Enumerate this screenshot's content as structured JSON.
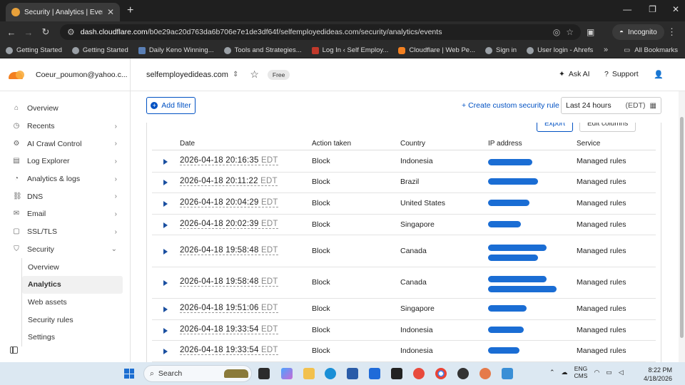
{
  "browser": {
    "tab_title": "Security | Analytics | Events | sel",
    "url_host": "dash.cloudflare.com",
    "url_path": "/b0e29ac20d763da6b706e7e1de3df64f/selfemployedideas.com/security/analytics/events",
    "incognito_label": "Incognito",
    "bookmarks": [
      {
        "label": "Getting Started",
        "icon": "globe-icon"
      },
      {
        "label": "Getting Started",
        "icon": "globe-icon"
      },
      {
        "label": "Daily Keno Winning...",
        "icon": "page-icon"
      },
      {
        "label": "Tools and Strategies...",
        "icon": "globe-icon"
      },
      {
        "label": "Log In ‹ Self Employ...",
        "icon": "page-icon"
      },
      {
        "label": "Cloudflare | Web Pe...",
        "icon": "cloudflare-icon"
      },
      {
        "label": "Sign in",
        "icon": "globe-icon"
      },
      {
        "label": "User login - Ahrefs",
        "icon": "globe-icon"
      }
    ],
    "all_bookmarks": "All Bookmarks"
  },
  "account": {
    "email": "Coeur_poumon@yahoo.c..."
  },
  "sidebar": {
    "items": [
      {
        "label": "Overview",
        "icon": "home-icon",
        "chevron": false
      },
      {
        "label": "Recents",
        "icon": "clock-icon",
        "chevron": true
      },
      {
        "label": "AI Crawl Control",
        "icon": "crawl-icon",
        "chevron": true
      },
      {
        "label": "Log Explorer",
        "icon": "log-icon",
        "chevron": true
      },
      {
        "label": "Analytics & logs",
        "icon": "chart-icon",
        "chevron": true
      },
      {
        "label": "DNS",
        "icon": "dns-icon",
        "chevron": true
      },
      {
        "label": "Email",
        "icon": "email-icon",
        "chevron": true
      },
      {
        "label": "SSL/TLS",
        "icon": "lock-icon",
        "chevron": true
      },
      {
        "label": "Security",
        "icon": "shield-icon",
        "chevron": "down"
      }
    ],
    "security_sub": [
      "Overview",
      "Analytics",
      "Web assets",
      "Security rules",
      "Settings"
    ]
  },
  "topbar": {
    "domain": "selfemployedideas.com",
    "plan": "Free",
    "ask_ai": "Ask AI",
    "support": "Support"
  },
  "toolbar": {
    "add_filter": "Add filter",
    "create_rule": "Create custom security rule",
    "time_range": "Last 24 hours",
    "timezone": "(EDT)",
    "export": "Export",
    "edit_columns": "Edit columns"
  },
  "table": {
    "columns": [
      "Date",
      "Action taken",
      "Country",
      "IP address",
      "Service"
    ],
    "rows": [
      {
        "date": "2026-04-18 20:16:35",
        "tz": "EDT",
        "action": "Block",
        "country": "Indonesia",
        "ip": "",
        "service": "Managed rules"
      },
      {
        "date": "2026-04-18 20:11:22",
        "tz": "EDT",
        "action": "Block",
        "country": "Brazil",
        "ip": "",
        "service": "Managed rules"
      },
      {
        "date": "2026-04-18 20:04:29",
        "tz": "EDT",
        "action": "Block",
        "country": "United States",
        "ip": "",
        "service": "Managed rules"
      },
      {
        "date": "2026-04-18 20:02:39",
        "tz": "EDT",
        "action": "Block",
        "country": "Singapore",
        "ip": "",
        "service": "Managed rules"
      },
      {
        "date": "2026-04-18 19:58:48",
        "tz": "EDT",
        "action": "Block",
        "country": "Canada",
        "ip": "",
        "service": "Managed rules"
      },
      {
        "date": "2026-04-18 19:58:48",
        "tz": "EDT",
        "action": "Block",
        "country": "Canada",
        "ip": "",
        "service": "Managed rules"
      },
      {
        "date": "2026-04-18 19:51:06",
        "tz": "EDT",
        "action": "Block",
        "country": "Singapore",
        "ip": "",
        "service": "Managed rules"
      },
      {
        "date": "2026-04-18 19:33:54",
        "tz": "EDT",
        "action": "Block",
        "country": "Indonesia",
        "ip": "",
        "service": "Managed rules"
      },
      {
        "date": "2026-04-18 19:33:54",
        "tz": "EDT",
        "action": "Block",
        "country": "Indonesia",
        "ip": "",
        "service": "Managed rules"
      }
    ]
  },
  "taskbar": {
    "search_placeholder": "Search",
    "lang1": "ENG",
    "lang2": "CMS",
    "time": "8:22 PM",
    "date": "4/18/2026"
  }
}
